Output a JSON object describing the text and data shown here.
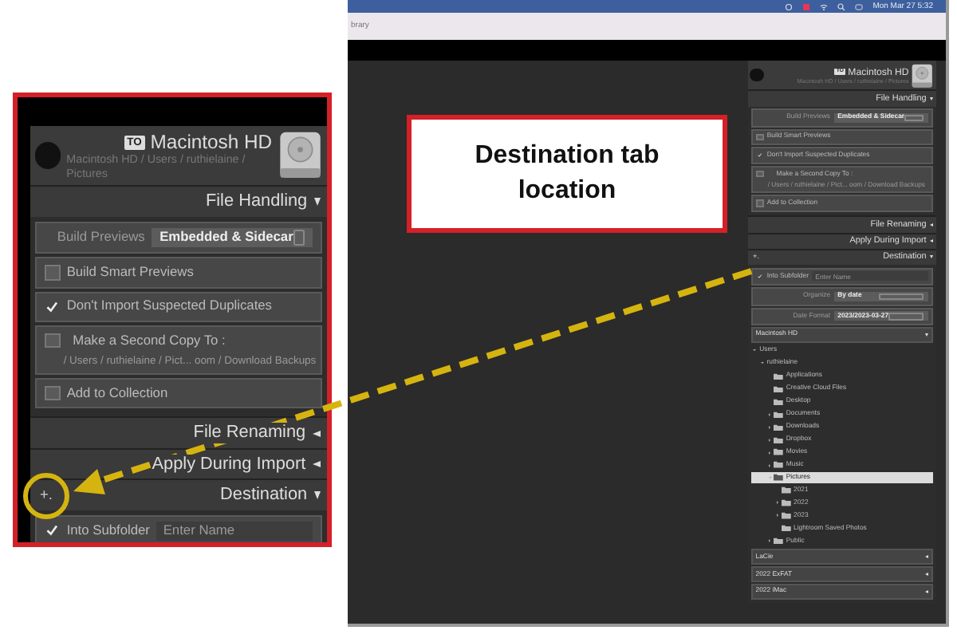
{
  "menu_bar": {
    "clock": "Mon Mar 27  5:32"
  },
  "app_bar": {
    "title": "brary"
  },
  "right_panel": {
    "header": {
      "badge": "TO",
      "volume": "Macintosh HD",
      "path": "Macintosh HD / Users / ruthielaine / Pictures"
    },
    "sections": [
      {
        "title": "File Handling",
        "expanded": true,
        "rows": [
          {
            "kind": "select",
            "label": "Build Previews",
            "value": "Embedded & Sidecar"
          },
          {
            "kind": "check",
            "label": "Build Smart Previews",
            "checked": false
          },
          {
            "kind": "check",
            "label": "Don't Import Suspected Duplicates",
            "checked": true
          },
          {
            "kind": "check",
            "label": "Make a Second Copy To :",
            "checked": false,
            "detail": "/ Users / ruthielaine / Pict... oom / Download Backups"
          },
          {
            "kind": "check",
            "label": "Add to Collection",
            "checked": false
          }
        ]
      },
      {
        "title": "File Renaming",
        "expanded": false
      },
      {
        "title": "Apply During Import",
        "expanded": false
      },
      {
        "title": "Destination",
        "expanded": true,
        "add_button": "+.",
        "rows": [
          {
            "kind": "check_field",
            "label": "Into Subfolder",
            "checked": true,
            "placeholder": "Enter Name"
          },
          {
            "kind": "select",
            "label": "Organize",
            "value": "By date"
          },
          {
            "kind": "select",
            "label": "Date Format",
            "value": "2023/2023-03-27"
          }
        ],
        "volumes": [
          {
            "name": "Macintosh HD",
            "expanded": true,
            "tree": [
              {
                "name": "Users",
                "selected": false,
                "expanded": true,
                "children": [
                  {
                    "name": "ruthielaine",
                    "selected": false,
                    "expanded": true,
                    "children": [
                      {
                        "name": "Applications",
                        "selected": false
                      },
                      {
                        "name": "Creative Cloud Files",
                        "selected": false
                      },
                      {
                        "name": "Desktop",
                        "selected": false
                      },
                      {
                        "name": "Documents",
                        "selected": false,
                        "expanded": false
                      },
                      {
                        "name": "Downloads",
                        "selected": false,
                        "expanded": false
                      },
                      {
                        "name": "Dropbox",
                        "selected": false,
                        "expanded": false
                      },
                      {
                        "name": "Movies",
                        "selected": false,
                        "expanded": false
                      },
                      {
                        "name": "Music",
                        "selected": false,
                        "expanded": false
                      },
                      {
                        "name": "Pictures",
                        "selected": true,
                        "expanded": true,
                        "children": [
                          {
                            "name": "2021",
                            "selected": false
                          },
                          {
                            "name": "2022",
                            "selected": false,
                            "expanded": false
                          },
                          {
                            "name": "2023",
                            "selected": false,
                            "expanded": false
                          },
                          {
                            "name": "Lightroom Saved Photos",
                            "selected": false
                          }
                        ]
                      },
                      {
                        "name": "Public",
                        "selected": false,
                        "expanded": false
                      }
                    ]
                  }
                ]
              }
            ]
          },
          {
            "name": "LaCie",
            "expanded": false
          },
          {
            "name": "2022 ExFAT",
            "expanded": false
          },
          {
            "name": "2022 iMac",
            "expanded": false
          }
        ]
      }
    ]
  },
  "zoom_inset": {
    "header": {
      "badge": "TO",
      "volume": "Macintosh HD",
      "path": "Macintosh HD / Users / ruthielaine / Pictures"
    },
    "sections": [
      {
        "title": "File Handling",
        "expanded": true,
        "rows": [
          {
            "kind": "select",
            "label": "Build Previews",
            "value": "Embedded & Sidecar"
          },
          {
            "kind": "check",
            "label": "Build Smart Previews",
            "checked": false
          },
          {
            "kind": "check",
            "label": "Don't Import Suspected Duplicates",
            "checked": true
          },
          {
            "kind": "check",
            "label": "Make a Second Copy To :",
            "checked": false,
            "detail": "/ Users / ruthielaine / Pict... oom / Download Backups"
          },
          {
            "kind": "check",
            "label": "Add to Collection",
            "checked": false
          }
        ]
      },
      {
        "title": "File Renaming",
        "expanded": false
      },
      {
        "title": "Apply During Import",
        "expanded": false
      },
      {
        "title": "Destination",
        "expanded": true,
        "add_button": "+.",
        "rows": [
          {
            "kind": "check_field",
            "label": "Into Subfolder",
            "checked": true,
            "placeholder": "Enter Name"
          }
        ]
      }
    ]
  },
  "callout": {
    "text": "Destination tab location"
  }
}
